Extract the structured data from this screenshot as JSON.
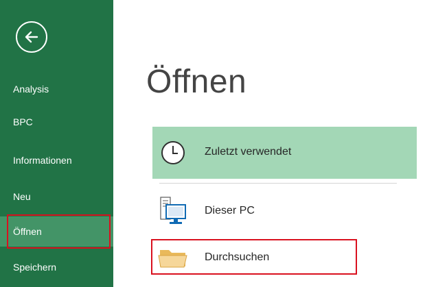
{
  "window": {
    "accent_color": "#217346",
    "selected_color": "#439467",
    "highlight_color": "#d9101e",
    "active_location_color": "#a3d7b6"
  },
  "sidebar": {
    "back_icon": "back-arrow-circle-icon",
    "items": [
      {
        "label": "Analysis"
      },
      {
        "label": "BPC"
      },
      {
        "label": "Informationen"
      },
      {
        "label": "Neu"
      },
      {
        "label": "Öffnen",
        "selected": true
      },
      {
        "label": "Speichern"
      }
    ]
  },
  "main": {
    "title": "Öffnen",
    "locations": [
      {
        "label": "Zuletzt verwendet",
        "icon": "clock-icon",
        "active": true
      },
      {
        "label": "Dieser PC",
        "icon": "computer-icon"
      },
      {
        "label": "Durchsuchen",
        "icon": "folder-icon"
      }
    ]
  }
}
